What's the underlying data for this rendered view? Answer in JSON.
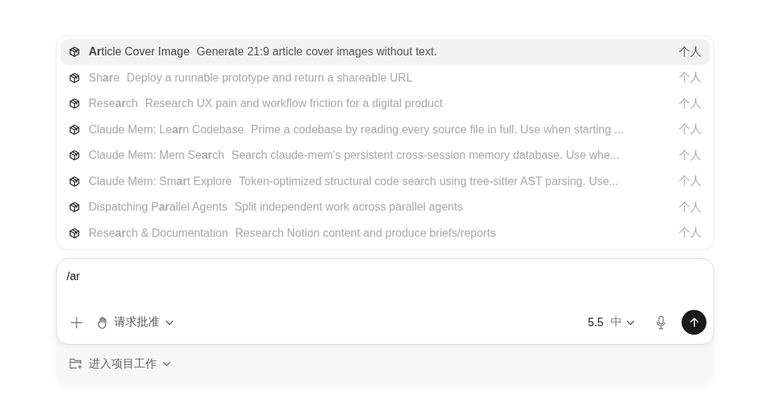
{
  "suggestions": [
    {
      "name": "**Ar**ticle Cover Image",
      "description": "Generate 21:9 article cover images without text.",
      "scope": "个人",
      "selected": true
    },
    {
      "name": "Sh**ar**e",
      "description": "Deploy a runnable prototype and return a shareable URL",
      "scope": "个人",
      "selected": false
    },
    {
      "name": "Rese**ar**ch",
      "description": "Research UX pain and workflow friction for a digital product",
      "scope": "个人",
      "selected": false
    },
    {
      "name": "Claude Mem: Le**ar**n Codebase",
      "description": "Prime a codebase by reading every source file in full. Use when starting ...",
      "scope": "个人",
      "selected": false
    },
    {
      "name": "Claude Mem: Mem Se**ar**ch",
      "description": "Search claude-mem's persistent cross-session memory database. Use whe...",
      "scope": "个人",
      "selected": false
    },
    {
      "name": "Claude Mem: Sm**ar**t Explore",
      "description": "Token-optimized structural code search using tree-sitter AST parsing. Use...",
      "scope": "个人",
      "selected": false
    },
    {
      "name": "Dispatching P**ar**allel Agents",
      "description": "Split independent work across parallel agents",
      "scope": "个人",
      "selected": false
    },
    {
      "name": "Rese**ar**ch & Documentation",
      "description": "Research Notion content and produce briefs/reports",
      "scope": "个人",
      "selected": false
    }
  ],
  "composer": {
    "value": "/ar",
    "approval": "请求批准",
    "model": "5.5",
    "effort": "中"
  },
  "project": {
    "label": "进入项目工作"
  }
}
